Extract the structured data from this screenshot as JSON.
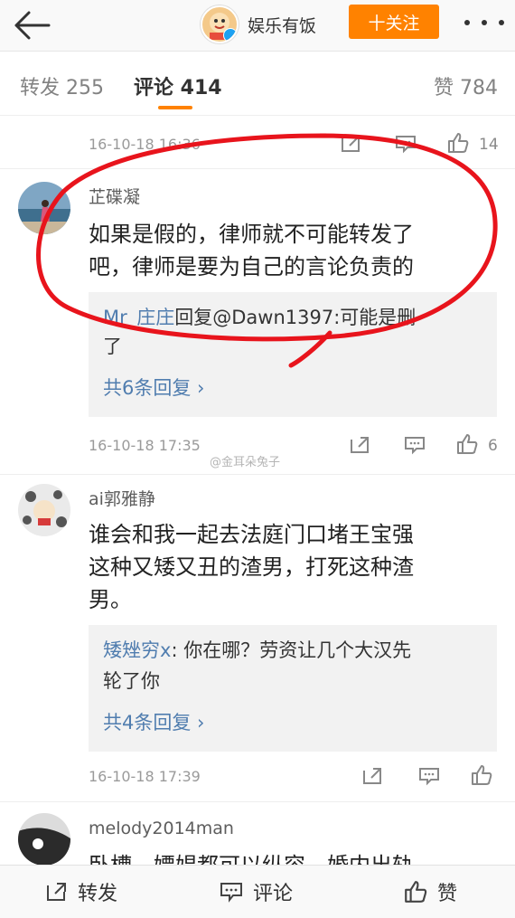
{
  "header": {
    "account_name": "娱乐有饭",
    "follow_label": "十关注"
  },
  "tabs": [
    {
      "label": "转发 255"
    },
    {
      "label": "评论 414"
    },
    {
      "label": "赞 784"
    }
  ],
  "comments": [
    {
      "time": "16-10-18 16:36",
      "likes": "14"
    },
    {
      "name": "芷碟凝",
      "text_lines": [
        "如果是假的，律师就不可能转发了",
        "吧，律师是要为自己的言论负责的"
      ],
      "reply": {
        "user": "Mr_庄庄",
        "line1_rest": "回复@Dawn1397:可能是删",
        "line2": "了"
      },
      "reply_more": "共6条回复 ›",
      "time": "16-10-18 17:35",
      "likes": "6"
    },
    {
      "name": "ai郭雅静",
      "text_lines": [
        "谁会和我一起去法庭门口堵王宝强",
        "这种又矮又丑的渣男，打死这种渣",
        "男。"
      ],
      "reply": {
        "user": "矮矬穷x",
        "line1_rest": ": 你在哪？劳资让几个大汉先",
        "line2": "轮了你"
      },
      "reply_more": "共4条回复 ›",
      "time": "16-10-18 17:39",
      "likes": ""
    },
    {
      "name": "melody2014man",
      "text_lines": [
        "卧槽，嫖娼都可以纵容，婚内出轨"
      ]
    }
  ],
  "watermark": "@金耳朵兔子",
  "bottom_bar": {
    "repost": "转发",
    "comment": "评论",
    "like": "赞"
  },
  "colors": {
    "accent": "#ff8200",
    "link": "#507daf",
    "annotation": "#e8141c"
  }
}
